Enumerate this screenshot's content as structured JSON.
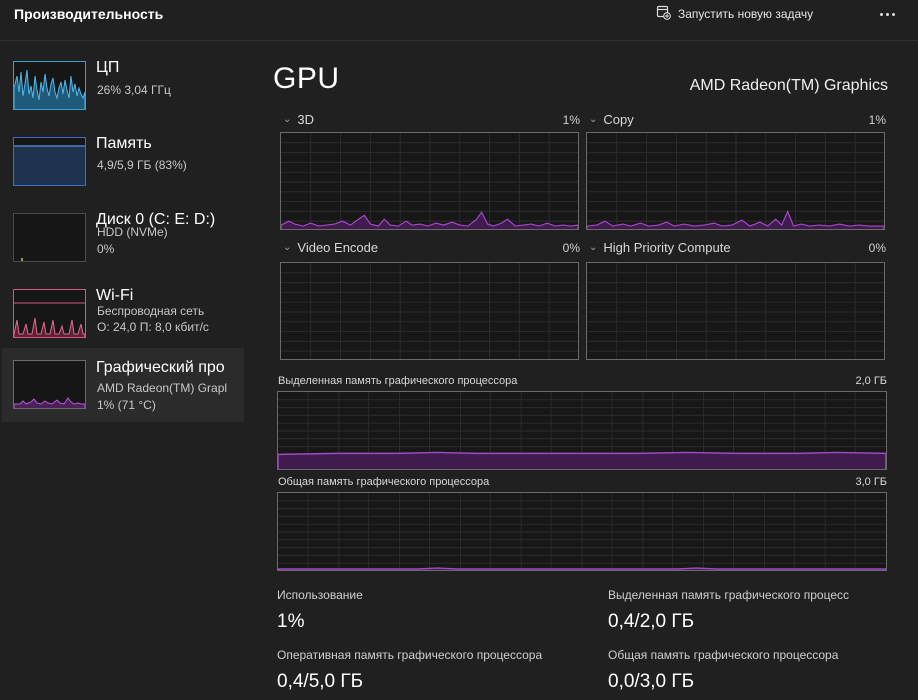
{
  "header": {
    "title": "Производительность",
    "run_task_label": "Запустить новую задачу",
    "run_task_icon": "run-task-icon",
    "more_icon": "more-options-icon"
  },
  "sidebar": {
    "items": [
      {
        "name": "ЦП",
        "line1": "26% 3,04 ГГц",
        "line2": ""
      },
      {
        "name": "Память",
        "line1": "4,9/5,9 ГБ (83%)",
        "line2": ""
      },
      {
        "name": "Диск 0 (C: E: D:)",
        "line1": "HDD (NVMe)",
        "line2": "0%"
      },
      {
        "name": "Wi-Fi",
        "line1": "Беспроводная сеть",
        "line2": "О: 24,0 П: 8,0 кбит/с"
      },
      {
        "name": "Графический про",
        "line1": "AMD Radeon(TM) Grapl",
        "line2": "1% (71 °C)"
      }
    ],
    "selected_index": 4
  },
  "main": {
    "title": "GPU",
    "gpu_name": "AMD Radeon(TM) Graphics",
    "engines": [
      {
        "label": "3D",
        "percent": "1%"
      },
      {
        "label": "Copy",
        "percent": "1%"
      },
      {
        "label": "Video Encode",
        "percent": "0%"
      },
      {
        "label": "High Priority Compute",
        "percent": "0%"
      }
    ],
    "dedicated_graph": {
      "label": "Выделенная память графического процессора",
      "max": "2,0 ГБ"
    },
    "shared_graph": {
      "label": "Общая память графического процессора",
      "max": "3,0 ГБ"
    },
    "stats": [
      {
        "label": "Использование",
        "value": "1%"
      },
      {
        "label": "Выделенная память графического процесс",
        "value": "0,4/2,0 ГБ"
      },
      {
        "label": "Оперативная память графического процессора",
        "value": "0,4/5,0 ГБ"
      },
      {
        "label": "Общая память графического процессора",
        "value": "0,0/3,0 ГБ"
      }
    ]
  },
  "colors": {
    "background": "#202020",
    "gpu_accent": "#a349c4",
    "cpu_accent": "#3a9fd4",
    "memory_accent": "#3a6fc4",
    "disk_accent": "#7aa644",
    "network_accent": "#d35a7a"
  }
}
